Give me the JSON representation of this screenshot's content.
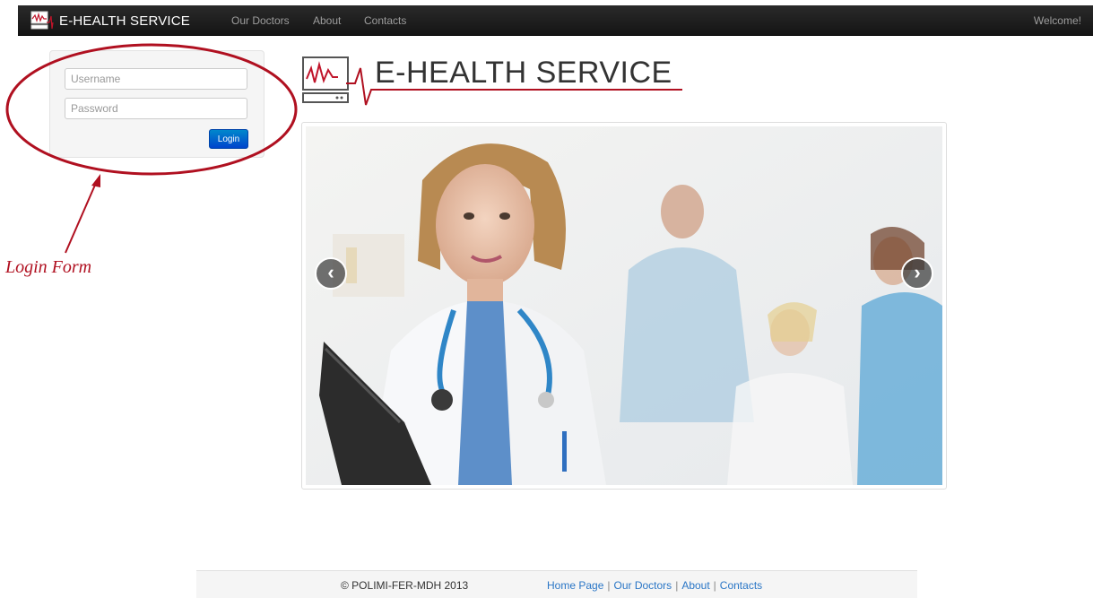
{
  "navbar": {
    "brand": "E-HEALTH SERVICE",
    "links": [
      "Our Doctors",
      "About",
      "Contacts"
    ],
    "welcome": "Welcome!"
  },
  "login": {
    "username_placeholder": "Username",
    "password_placeholder": "Password",
    "button_label": "Login"
  },
  "annotation": {
    "label": "Login Form",
    "color": "#b01020"
  },
  "header": {
    "title": "E-HEALTH SERVICE"
  },
  "carousel": {
    "prev_symbol": "‹",
    "next_symbol": "›",
    "image_icon": "doctor-photo"
  },
  "footer": {
    "copyright": "© POLIMI-FER-MDH 2013",
    "links": [
      "Home Page",
      "Our Doctors",
      "About",
      "Contacts"
    ]
  },
  "colors": {
    "navbar": "#1b1b1b",
    "accent_red": "#b01020",
    "link_blue": "#2a76c6",
    "button_blue": "#0066cc"
  }
}
